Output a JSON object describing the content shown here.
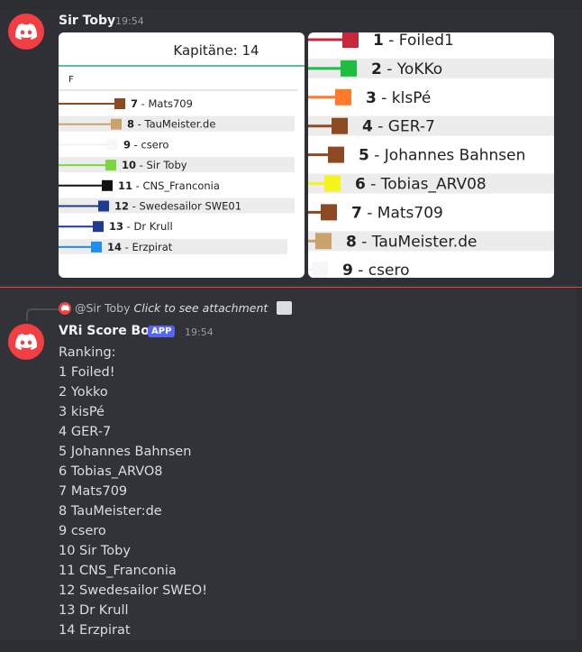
{
  "messages": [
    {
      "author": "Sir Toby",
      "timestamp": "19:54",
      "attachment": {
        "left_panel": {
          "title": "Kapitäne: 14",
          "filter_text": "F",
          "rows": [
            {
              "rank": "7",
              "name": "Mats709",
              "color": "#8b4a24"
            },
            {
              "rank": "8",
              "name": "TauMeister.de",
              "color": "#c9a36b"
            },
            {
              "rank": "9",
              "name": "csero",
              "color": "#ffffff"
            },
            {
              "rank": "10",
              "name": "Sir Toby",
              "color": "#7bd640"
            },
            {
              "rank": "11",
              "name": "CNS_Franconia",
              "color": "#111111"
            },
            {
              "rank": "12",
              "name": "Swedesailor SWE01",
              "color": "#1f3a93"
            },
            {
              "rank": "13",
              "name": "Dr Krull",
              "color": "#1f3a93"
            },
            {
              "rank": "14",
              "name": "Erzpirat",
              "color": "#1e8ef0"
            }
          ]
        },
        "right_panel": {
          "rows": [
            {
              "rank": "1",
              "name": "Foiled1",
              "color": "#c8263a"
            },
            {
              "rank": "2",
              "name": "YoKKo",
              "color": "#1dbd3f"
            },
            {
              "rank": "3",
              "name": "klsPé",
              "color": "#ff7a2b"
            },
            {
              "rank": "4",
              "name": "GER-7",
              "color": "#8b4a24"
            },
            {
              "rank": "5",
              "name": "Johannes Bahnsen",
              "color": "#8b4a24"
            },
            {
              "rank": "6",
              "name": "Tobias_ARV08",
              "color": "#f5f51e"
            },
            {
              "rank": "7",
              "name": "Mats709",
              "color": "#8b4a24"
            },
            {
              "rank": "8",
              "name": "TauMeister.de",
              "color": "#c9a36b"
            },
            {
              "rank": "9",
              "name": "csero",
              "color": "#ffffff"
            }
          ]
        }
      }
    },
    {
      "reply_to": "@Sir Toby",
      "reply_cta": "Click to see attachment",
      "author": "VRi Score Bot",
      "badge": "APP",
      "timestamp": "19:54",
      "lines": [
        "Ranking:",
        "1 Foiled!",
        "2 Yokko",
        "3 kisPé",
        "4 GER-7",
        "5 Johannes Bahnsen",
        "6 Tobias_ARVO8",
        "7 Mats709",
        "8 TauMeister:de",
        "9 csero",
        "10 Sir Toby",
        "11 CNS_Franconia",
        "12 Swedesailor SWEO!",
        "13 Dr Krull",
        "14 Erzpirat"
      ]
    }
  ],
  "colors": {
    "background": "#313338",
    "accent": "#5865f2",
    "avatar": "#f23f43",
    "new_messages_line": "#f23f43"
  }
}
